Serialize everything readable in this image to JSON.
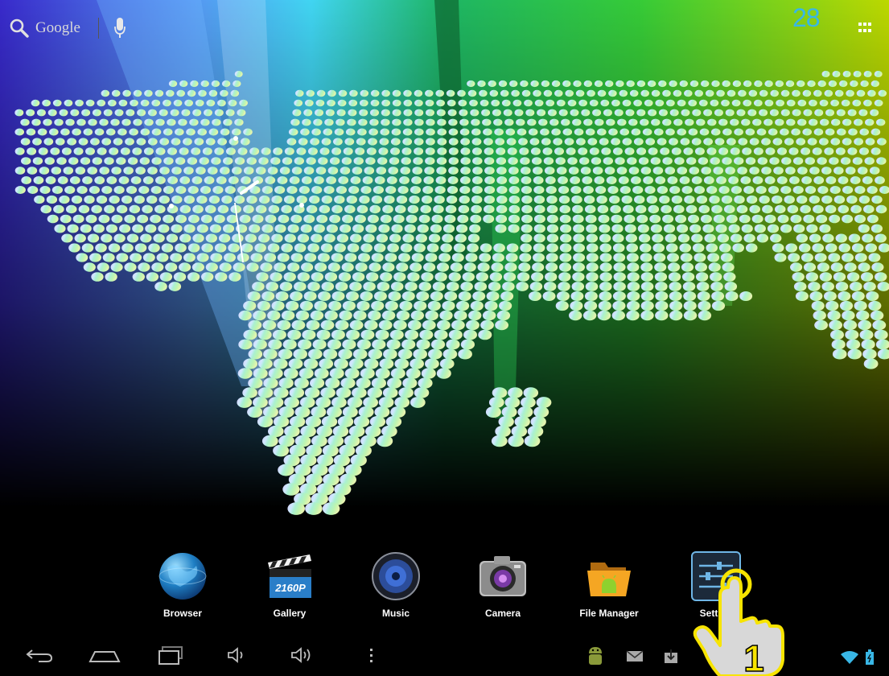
{
  "search": {
    "label": "Google",
    "icon": "search-icon",
    "voice_icon": "microphone-icon"
  },
  "apps_button": {
    "icon": "apps-grid-icon"
  },
  "dock": {
    "apps": [
      {
        "label": "Browser",
        "icon": "globe-icon"
      },
      {
        "label": "Gallery",
        "icon": "clapperboard-icon",
        "badge": "2160P"
      },
      {
        "label": "Music",
        "icon": "speaker-icon"
      },
      {
        "label": "Camera",
        "icon": "camera-icon"
      },
      {
        "label": "File Manager",
        "icon": "folder-android-icon"
      },
      {
        "label": "Settings",
        "icon": "sliders-icon",
        "visible_text": "Setting"
      }
    ]
  },
  "navbar": {
    "buttons": [
      "back-icon",
      "home-icon",
      "recent-apps-icon",
      "volume-down-icon",
      "volume-up-icon",
      "menu-icon"
    ]
  },
  "status": {
    "notifications": [
      "android-icon",
      "mail-icon",
      "download-icon"
    ],
    "time": "28",
    "icons": [
      "wifi-icon",
      "battery-icon"
    ]
  },
  "tutorial": {
    "step": "1",
    "highlight_color": "#f7e400"
  },
  "colors": {
    "clock": "#39b7e6",
    "accent": "#f7e400"
  }
}
